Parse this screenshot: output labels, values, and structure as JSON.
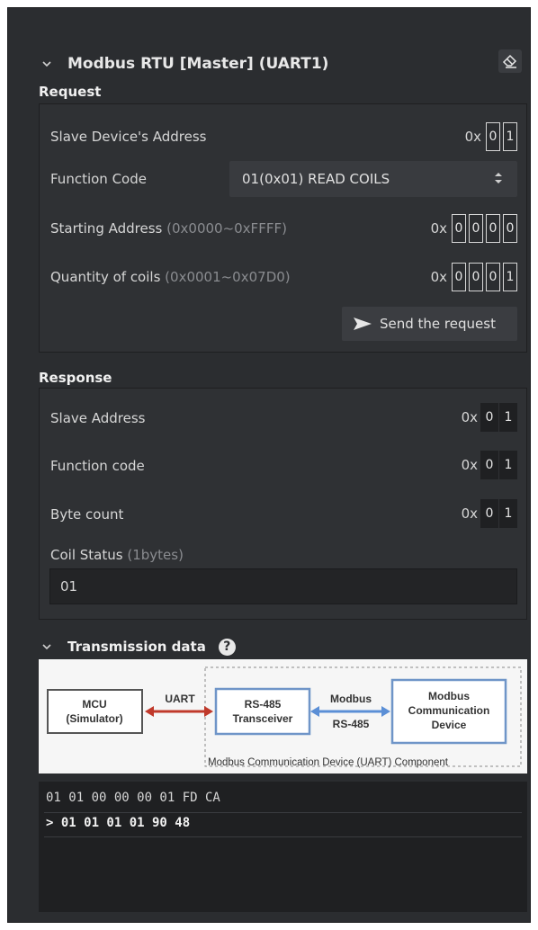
{
  "panel": {
    "title": "Modbus RTU [Master] (UART1)"
  },
  "request": {
    "label": "Request",
    "slave_address": {
      "label": "Slave Device's Address",
      "prefix": "0x",
      "digits": [
        "0",
        "1"
      ]
    },
    "function_code": {
      "label": "Function Code",
      "selected": "01(0x01) READ COILS"
    },
    "starting_address": {
      "label": "Starting Address",
      "hint": "(0x0000~0xFFFF)",
      "prefix": "0x",
      "digits": [
        "0",
        "0",
        "0",
        "0"
      ]
    },
    "quantity": {
      "label": "Quantity of coils",
      "hint": "(0x0001~0x07D0)",
      "prefix": "0x",
      "digits": [
        "0",
        "0",
        "0",
        "1"
      ]
    },
    "send_label": "Send the request"
  },
  "response": {
    "label": "Response",
    "slave_address": {
      "label": "Slave Address",
      "prefix": "0x",
      "digits": [
        "0",
        "1"
      ]
    },
    "function_code": {
      "label": "Function code",
      "prefix": "0x",
      "digits": [
        "0",
        "1"
      ]
    },
    "byte_count": {
      "label": "Byte count",
      "prefix": "0x",
      "digits": [
        "0",
        "1"
      ]
    },
    "coil_status": {
      "label": "Coil Status",
      "hint": "(1bytes)",
      "value": "01"
    }
  },
  "transmission": {
    "title": "Transmission data",
    "help_glyph": "?",
    "diagram": {
      "mcu_line1": "MCU",
      "mcu_line2": "(Simulator)",
      "uart": "UART",
      "rs485_line1": "RS-485",
      "rs485_line2": "Transceiver",
      "modbus_top": "Modbus",
      "modbus_bottom": "RS-485",
      "device_line1": "Modbus",
      "device_line2": "Communication",
      "device_line3": "Device",
      "component_caption": "Modbus Communication Device (UART) Component"
    },
    "log": [
      {
        "text": "01 01 00 00 00 01 FD CA",
        "type": "sent"
      },
      {
        "text": "> 01 01 01 01 90 48",
        "type": "received"
      }
    ]
  },
  "colors": {
    "panel_bg": "#2b2d30",
    "section_bg": "#2f3134",
    "arrow_uart": "#c0392b",
    "arrow_modbus": "#5b8fd6",
    "box_blue": "#6f95c8"
  },
  "icons": {
    "collapse": "chevron-down-icon",
    "clear": "eraser-icon",
    "select": "updown-icon",
    "send": "send-arrow-icon",
    "help": "help-icon"
  }
}
